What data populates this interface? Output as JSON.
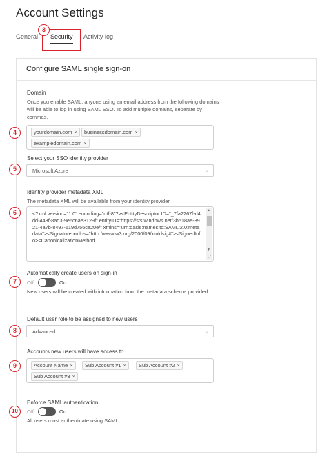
{
  "page": {
    "title": "Account Settings"
  },
  "tabs": [
    {
      "label": "General"
    },
    {
      "label": "Security"
    },
    {
      "label": "Activity log"
    }
  ],
  "markers": [
    "3",
    "4",
    "5",
    "6",
    "7",
    "8",
    "9",
    "10"
  ],
  "card": {
    "title": "Configure SAML single sign-on",
    "domain": {
      "label": "Domain",
      "help": "Once you enable SAML, anyone using an email address from the following domains will be able to log in using SAML SSO. To add multiple domains, separate by commas.",
      "tags": [
        "yourdomain.com",
        "businessdomain.com",
        "exampledomain.com"
      ]
    },
    "provider": {
      "label": "Select your SSO identity provider",
      "value": "Microsoft Azure"
    },
    "metadata": {
      "label": "Identity provider metadata XML",
      "help": "The metadata XML will be available from your identity provider",
      "value": "<?xml version=\"1.0\" encoding=\"utf-8\"?><EntityDescriptor ID=\"_7fa2267f-d4dd-443f-8ad3-9e6c6ae3129f\" entityID=\"https://sts.windows.net/3b518ae-8921-4a7b-8497-619d756ce20e/\" xmlns=\"urn:oasis:names:tc:SAML:2.0:metadata\"><Signature xmlns=\"http://www.w3.org/2000/09/xmldsig#\"><SignedInfo><CanonicalizationMethod"
    },
    "auto_create": {
      "label": "Automatically create users on sign-in",
      "off_label": "Off",
      "on_label": "On",
      "help": "New users will be created with information from the metadata schema provided."
    },
    "default_role": {
      "label": "Default user role to be assigned to new users",
      "value": "Advanced"
    },
    "access": {
      "label": "Accounts new users will have access to",
      "tags": [
        "Account Name",
        "Sub Account #1",
        "Sub Account #2",
        "Sub Account #3"
      ]
    },
    "enforce": {
      "label": "Enforce SAML authentication",
      "off_label": "Off",
      "on_label": "On",
      "help": "All users must authenticate using SAML."
    }
  },
  "icons": {
    "tag_remove": "×",
    "chevron": "⌵"
  }
}
